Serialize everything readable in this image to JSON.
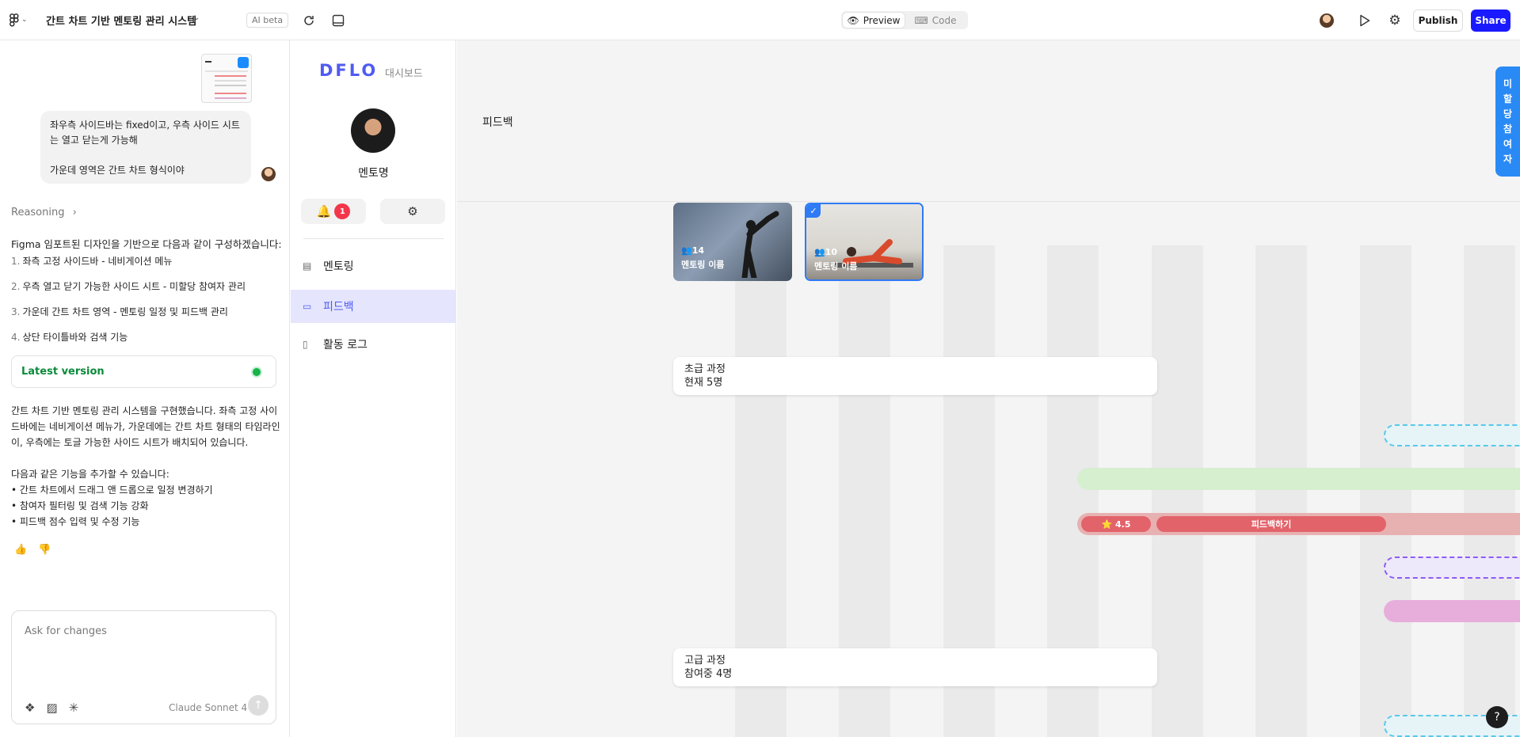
{
  "topbar": {
    "project_title": "간트 차트 기반 멘토링 관리 시스템",
    "ai_badge": "AI beta",
    "preview_label": "Preview",
    "code_label": "Code",
    "publish_label": "Publish",
    "share_label": "Share"
  },
  "chat": {
    "user_message": "좌우측 사이드바는 fixed이고, 우측 사이드 시트는 열고 닫는게 가능해\n\n가운데 영역은 간트 차트 형식이야",
    "reasoning_label": "Reasoning",
    "intro": "Figma 임포트된 디자인을 기반으로 다음과 같이 구성하겠습니다:",
    "steps": [
      {
        "n": "1.",
        "text": "좌측 고정 사이드바 - 네비게이션 메뉴"
      },
      {
        "n": "2.",
        "text": "우측 열고 닫기 가능한 사이드 시트 - 미할당 참여자 관리"
      },
      {
        "n": "3.",
        "text": "가운데 간트 차트 영역 - 멘토링 일정 및 피드백 관리"
      },
      {
        "n": "4.",
        "text": "상단 타이틀바와 검색 기능"
      }
    ],
    "latest_version": "Latest version",
    "summary": "간트 차트 기반 멘토링 관리 시스템을 구현했습니다. 좌측 고정 사이드바에는 네비게이션 메뉴가, 가운데에는 간트 차트 형태의 타임라인이, 우측에는 토글 가능한 사이드 시트가 배치되어 있습니다.",
    "features_intro": "다음과 같은 기능을 추가할 수 있습니다:",
    "features": [
      "• 간트 차트에서 드래그 앤 드롭으로 일정 변경하기",
      "• 참여자 필터링 및 검색 기능 강화",
      "• 피드백 점수 입력 및 수정 기능"
    ],
    "ask_placeholder": "Ask for changes",
    "model": "Claude Sonnet 4"
  },
  "app": {
    "brand": "DFLO",
    "brand_sub": "대시보드",
    "profile_name": "멘토명",
    "notification_count": "1",
    "nav": [
      {
        "label": "멘토링",
        "icon": "clipboard-icon"
      },
      {
        "label": "피드백",
        "icon": "message-icon"
      },
      {
        "label": "활동 로그",
        "icon": "document-icon"
      }
    ],
    "active_nav": 1
  },
  "canvas": {
    "page_title": "피드백",
    "cards": [
      {
        "count": "👥14",
        "name": "멘토링 이름",
        "selected": false
      },
      {
        "count": "👥10",
        "name": "멘토링 이름",
        "selected": true
      }
    ],
    "courses": [
      {
        "title": "초급 과정",
        "sub": "현재 5명"
      },
      {
        "title": "고급 과정",
        "sub": "참여중 4명"
      }
    ],
    "rating": "⭐ 4.5",
    "feedback_button": "피드백하기",
    "side_tab": "미\n할\n당\n참\n여\n자",
    "colors": {
      "accent": "#4f5bf2",
      "share": "#1a1aff",
      "side_tab": "#2a8af5",
      "red_bar": "#e3636b"
    }
  }
}
